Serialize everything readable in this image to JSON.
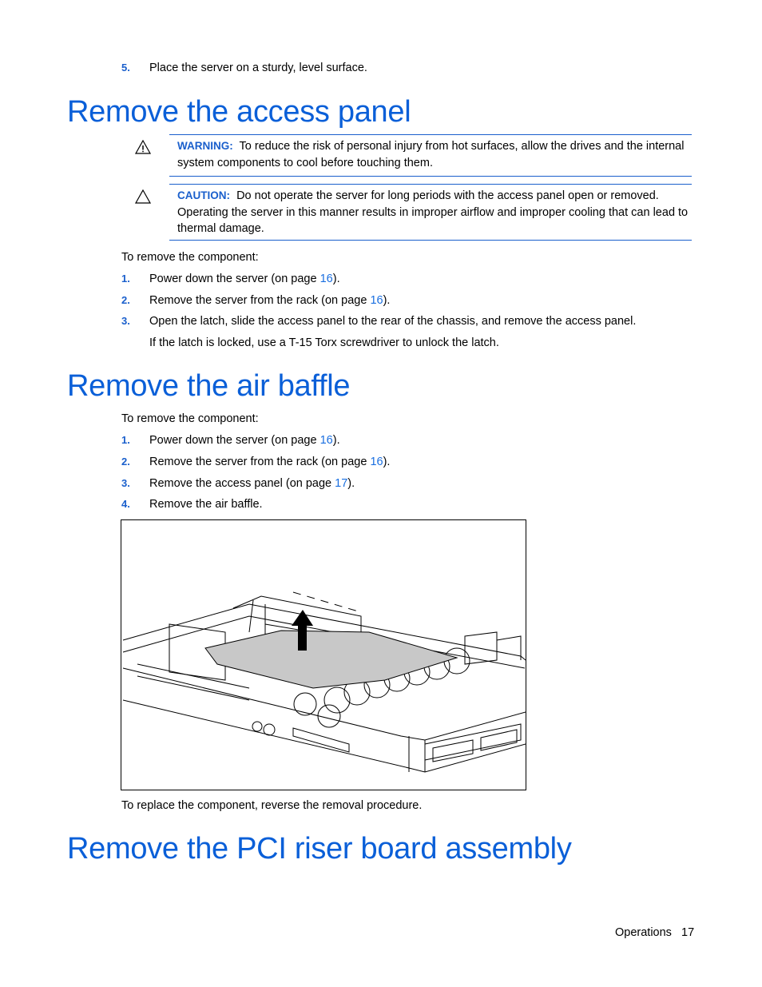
{
  "top_step": {
    "number": "5.",
    "text": "Place the server on a sturdy, level surface."
  },
  "sections": [
    {
      "title": "Remove the access panel",
      "notes": [
        {
          "icon": "warning-icon",
          "label": "WARNING:",
          "text": "To reduce the risk of personal injury from hot surfaces, allow the drives and the internal system components to cool before touching them."
        },
        {
          "icon": "caution-icon",
          "label": "CAUTION:",
          "text": "Do not operate the server for long periods with the access panel open or removed. Operating the server in this manner results in improper airflow and improper cooling that can lead to thermal damage."
        }
      ],
      "intro": "To remove the component:",
      "steps": [
        {
          "number": "1.",
          "before": "Power down the server (on page ",
          "link": "16",
          "after": ")."
        },
        {
          "number": "2.",
          "before": "Remove the server from the rack (on page ",
          "link": "16",
          "after": ")."
        },
        {
          "number": "3.",
          "before": "Open the latch, slide the access panel to the rear of the chassis, and remove the access panel.",
          "link": "",
          "after": ""
        }
      ],
      "step_note": "If the latch is locked, use a T-15 Torx screwdriver to unlock the latch."
    },
    {
      "title": "Remove the air baffle",
      "intro": "To remove the component:",
      "steps": [
        {
          "number": "1.",
          "before": "Power down the server (on page ",
          "link": "16",
          "after": ")."
        },
        {
          "number": "2.",
          "before": "Remove the server from the rack (on page ",
          "link": "16",
          "after": ")."
        },
        {
          "number": "3.",
          "before": "Remove the access panel (on page ",
          "link": "17",
          "after": ")."
        },
        {
          "number": "4.",
          "before": "Remove the air baffle.",
          "link": "",
          "after": ""
        }
      ],
      "figure_alt": "Server chassis with air baffle being lifted upward (arrow)",
      "outro": "To replace the component, reverse the removal procedure."
    },
    {
      "title": "Remove the PCI riser board assembly"
    }
  ],
  "footer": {
    "section": "Operations",
    "page": "17"
  }
}
